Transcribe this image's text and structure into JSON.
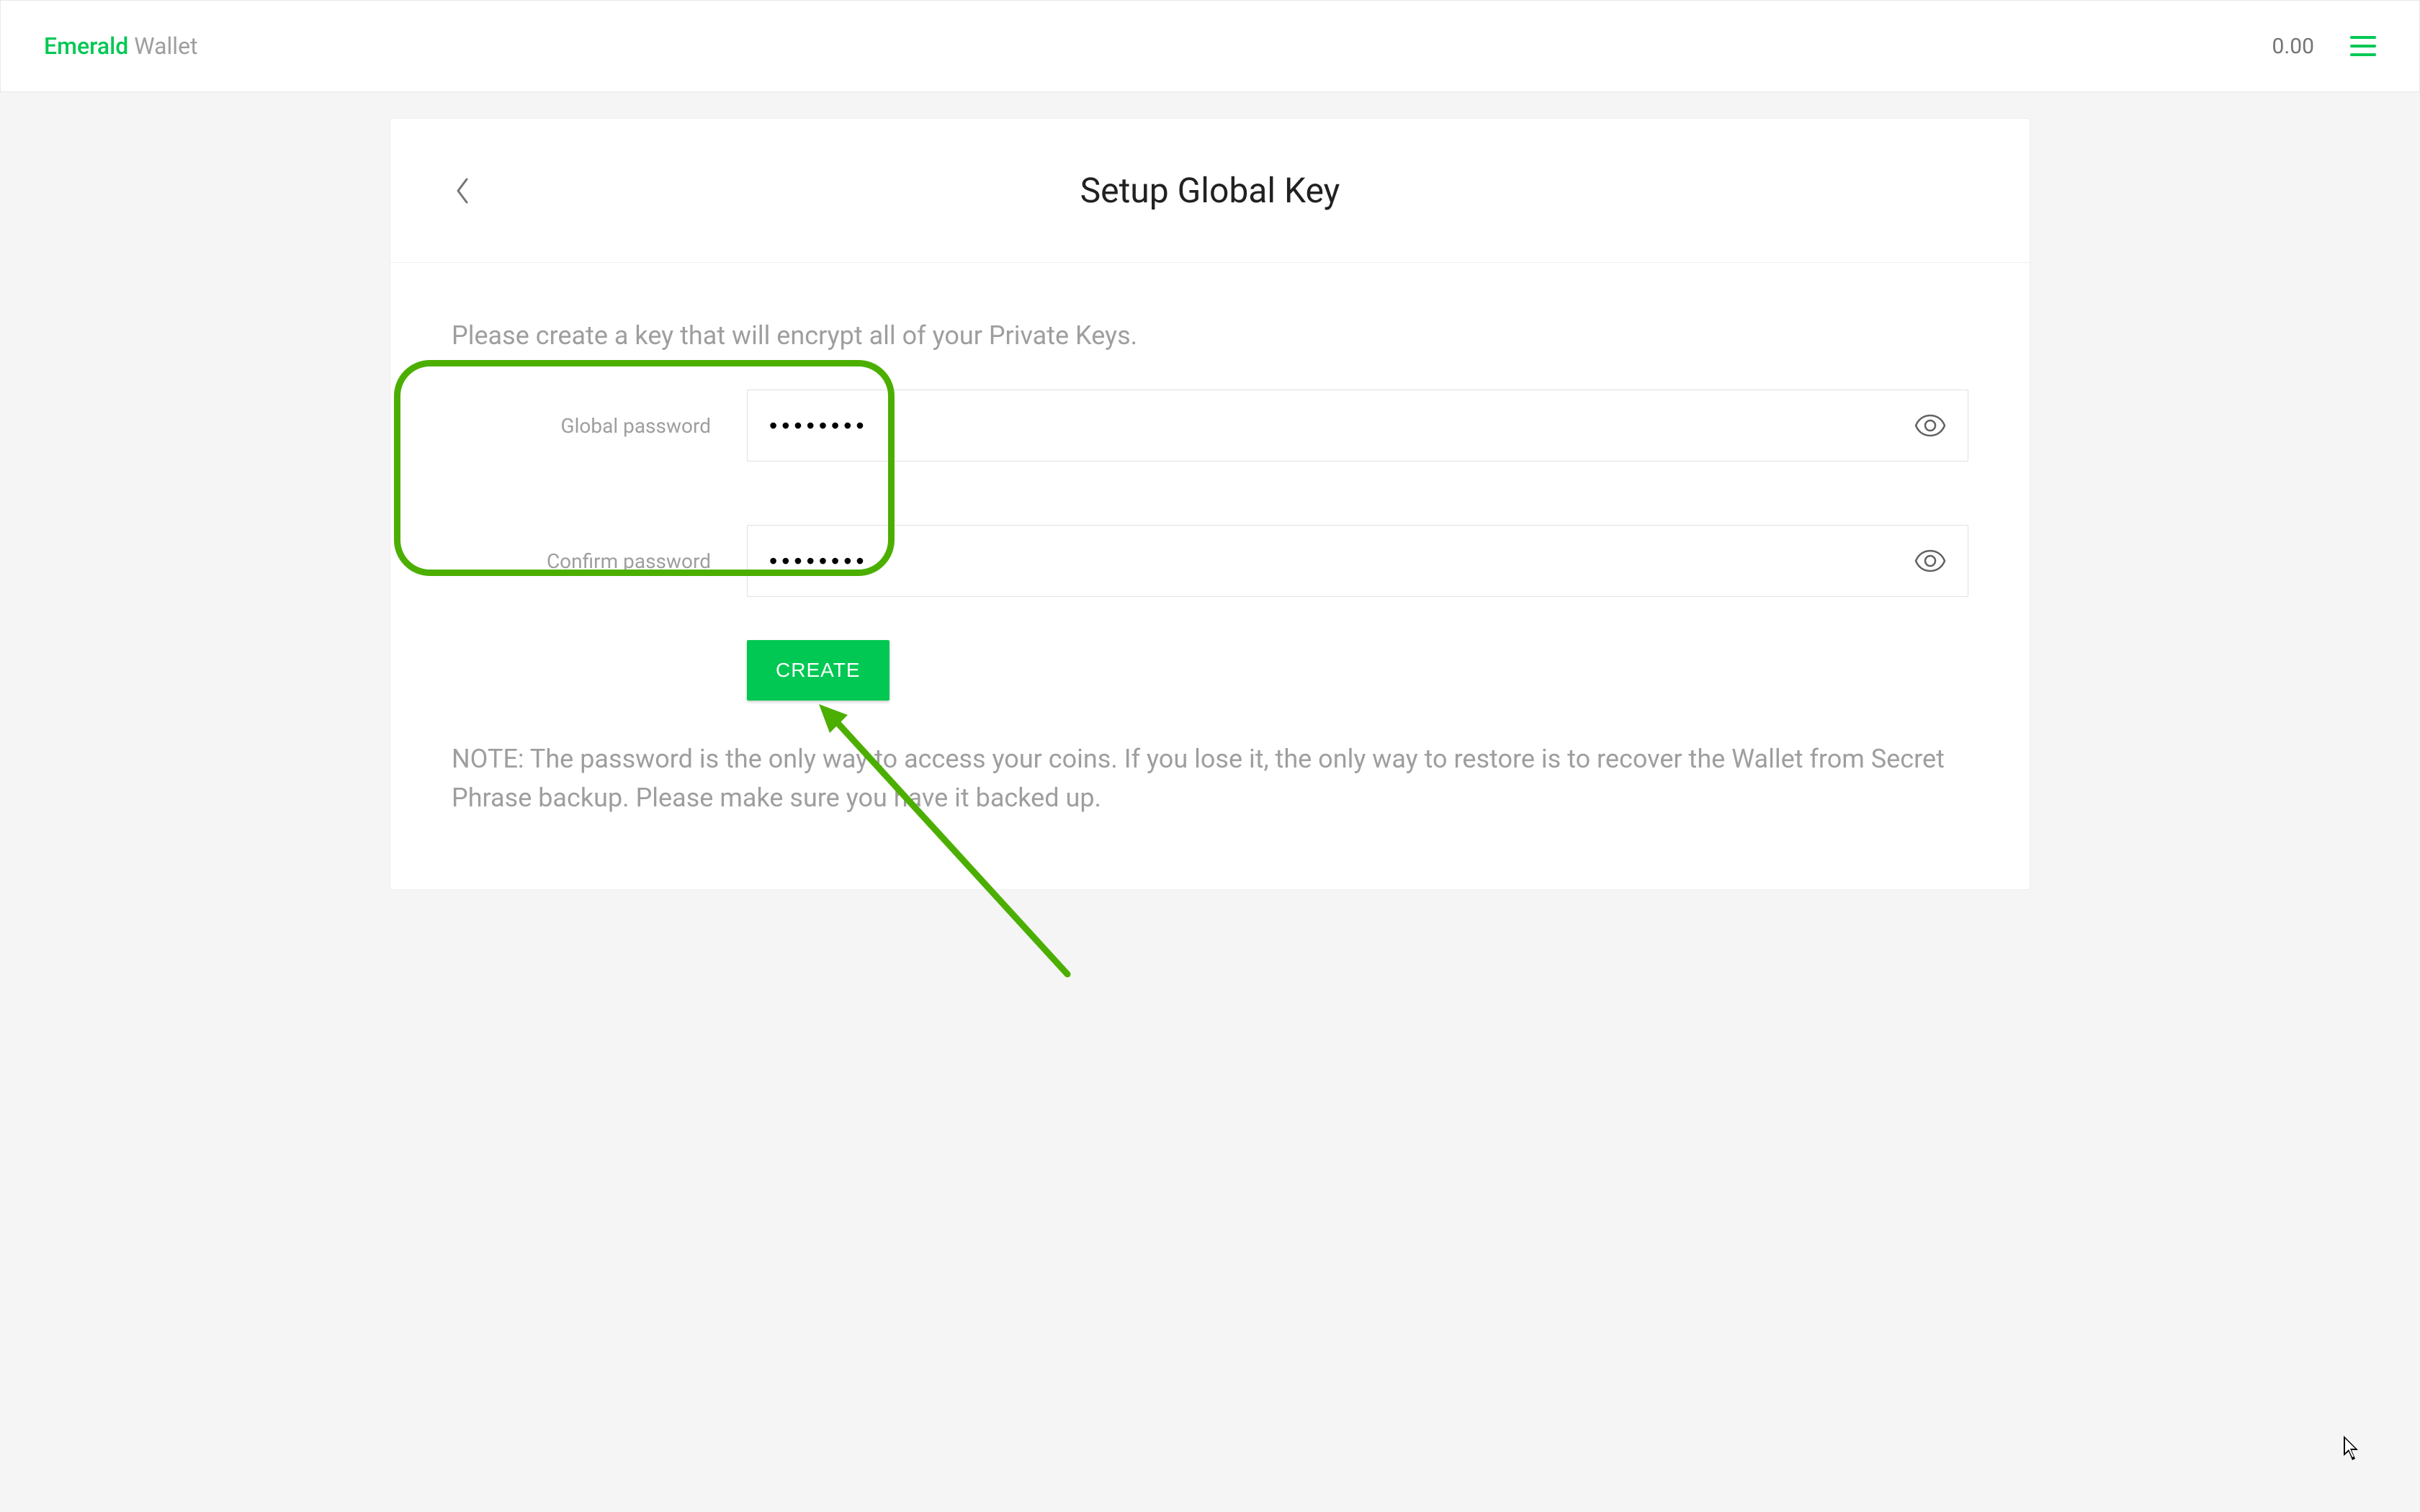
{
  "header": {
    "brand_emerald": "Emerald",
    "brand_wallet": " Wallet",
    "balance": "0.00"
  },
  "page": {
    "title": "Setup Global Key",
    "intro": "Please create a key that will encrypt all of your Private Keys.",
    "note": "NOTE: The password is the only way to access your coins. If you lose it, the only way to restore is to recover the Wallet from Secret Phrase backup. Please make sure you have it backed up."
  },
  "form": {
    "global_password_label": "Global password",
    "confirm_password_label": "Confirm password",
    "global_password_value": "••••••••",
    "confirm_password_value": "••••••••",
    "create_button_label": "CREATE"
  }
}
